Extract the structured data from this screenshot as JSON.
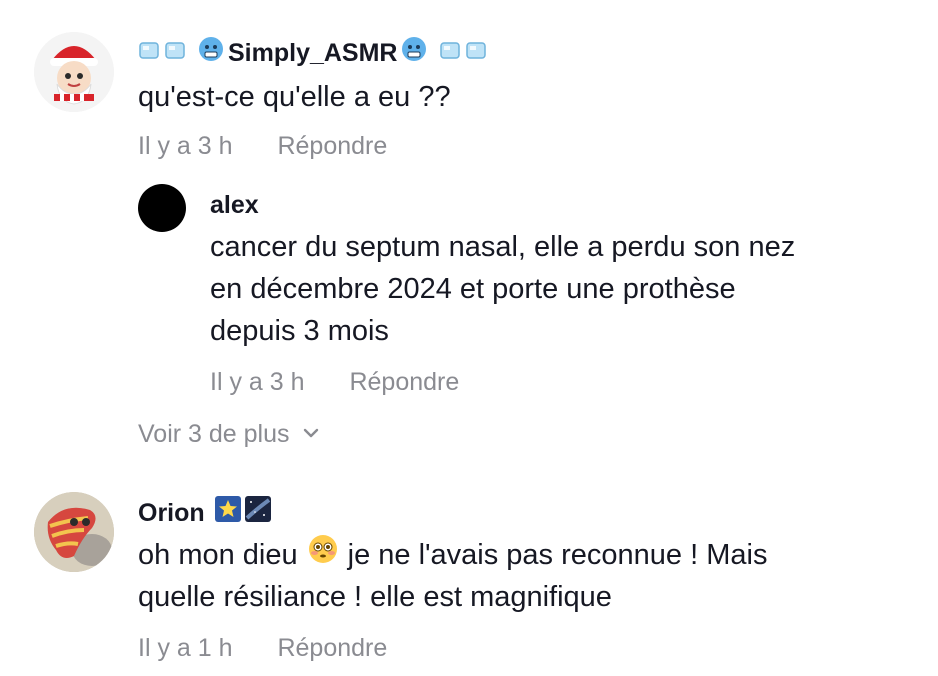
{
  "comments": [
    {
      "username": "Simply_ASMR",
      "text": "qu'est-ce qu'elle a eu ??",
      "time": "Il y a 3 h",
      "reply_label": "Répondre",
      "replies": [
        {
          "username": "alex",
          "text_lines": [
            "cancer du septum nasal, elle a perdu son nez",
            "en décembre 2024 et porte une prothèse",
            "depuis 3 mois"
          ],
          "time": "Il y a 3 h",
          "reply_label": "Répondre"
        }
      ],
      "more_label": "Voir 3 de plus"
    },
    {
      "username": "Orion",
      "text_lines": [
        "oh mon dieu",
        "je ne l'avais pas reconnue ! Mais",
        "quelle résiliance ! elle est magnifique"
      ],
      "time": "Il y a 1 h",
      "reply_label": "Répondre"
    }
  ],
  "icons": {
    "ice_cube": "ice-cube-icon",
    "cold_face": "cold-face-icon",
    "flushed_face": "flushed-face-emoji-icon",
    "star": "glowing-star-icon",
    "milky_way": "milky-way-icon"
  },
  "colors": {
    "text": "#161823",
    "meta": "#8a8b91",
    "accent_blue": "#3aa0e8"
  }
}
